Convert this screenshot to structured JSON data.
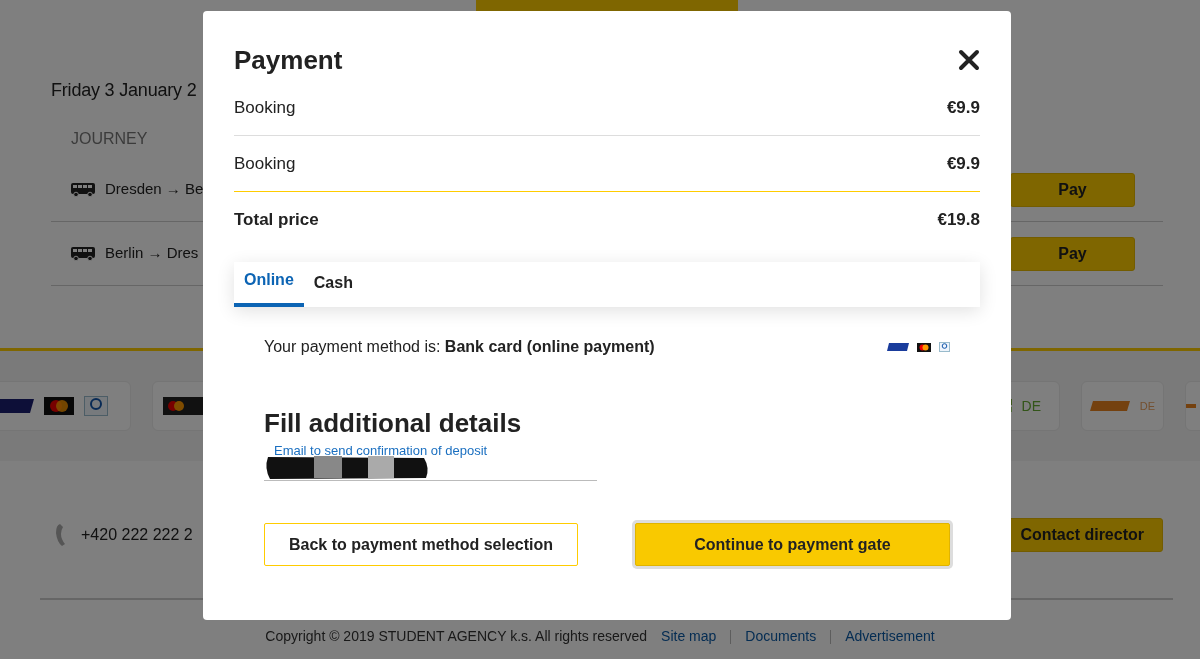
{
  "background": {
    "date_heading": "Friday 3 January 2",
    "journey_header": "JOURNEY",
    "journeys": [
      {
        "route": "Dresden → Be",
        "button": "Pay"
      },
      {
        "route": "Berlin → Dres",
        "button": "Pay"
      }
    ],
    "payment_logos": [
      {
        "kind": "cards"
      },
      {
        "kind": "masterpass"
      },
      {
        "kind": "instant",
        "label": "DE"
      },
      {
        "kind": "sofort",
        "label": "DE"
      },
      {
        "kind": "partial"
      }
    ],
    "phone": "+420 222 222 2",
    "contact_button": "Contact director",
    "copyright": "Copyright © 2019 STUDENT AGENCY k.s. All rights reserved",
    "footer_links": [
      "Site map",
      "Documents",
      "Advertisement"
    ]
  },
  "modal": {
    "title": "Payment",
    "price_rows": [
      {
        "kind": "item",
        "label": "Booking",
        "price": "€9.9"
      },
      {
        "kind": "item",
        "label": "Booking",
        "price": "€9.9"
      },
      {
        "kind": "total",
        "label": "Total price",
        "price": "€19.8"
      }
    ],
    "tabs": [
      {
        "label": "Online",
        "selected": true
      },
      {
        "label": "Cash",
        "selected": false
      }
    ],
    "payment_method": "Your payment method is: **Bank card (online payment)**",
    "section_title": "Fill additional details",
    "email_field": {
      "label": "Email to send confirmation of deposit"
    },
    "buttons": [
      {
        "kind": "secondary",
        "label": "Back to payment method selection"
      },
      {
        "kind": "primary",
        "label": "Continue to payment gate"
      }
    ]
  }
}
